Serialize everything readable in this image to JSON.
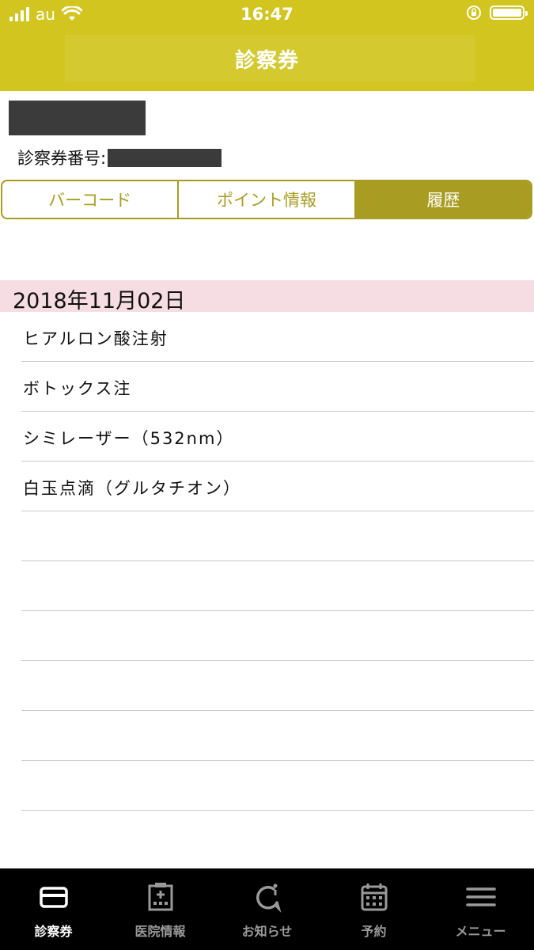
{
  "status_bar": {
    "carrier": "au",
    "time": "16:47"
  },
  "header": {
    "title": "診察券"
  },
  "patient": {
    "card_number_label": "診察券番号:"
  },
  "tabs": [
    {
      "label": "バーコード",
      "active": false
    },
    {
      "label": "ポイント情報",
      "active": false
    },
    {
      "label": "履歴",
      "active": true
    }
  ],
  "history": {
    "date": "2018年11月02日",
    "items": [
      "ヒアルロン酸注射",
      "ボトックス注",
      "シミレーザー（532nm）",
      "白玉点滴（グルタチオン）",
      "",
      "",
      "",
      "",
      "",
      "",
      ""
    ]
  },
  "bottom_nav": [
    {
      "label": "診察券",
      "icon": "card-icon",
      "active": true
    },
    {
      "label": "医院情報",
      "icon": "hospital-icon",
      "active": false
    },
    {
      "label": "お知らせ",
      "icon": "notification-icon",
      "active": false
    },
    {
      "label": "予約",
      "icon": "calendar-icon",
      "active": false
    },
    {
      "label": "メニュー",
      "icon": "menu-icon",
      "active": false
    }
  ],
  "colors": {
    "header": "#d2c51f",
    "accent": "#a89d22",
    "date_band": "#f6dde3",
    "nav_bg": "#000000"
  }
}
